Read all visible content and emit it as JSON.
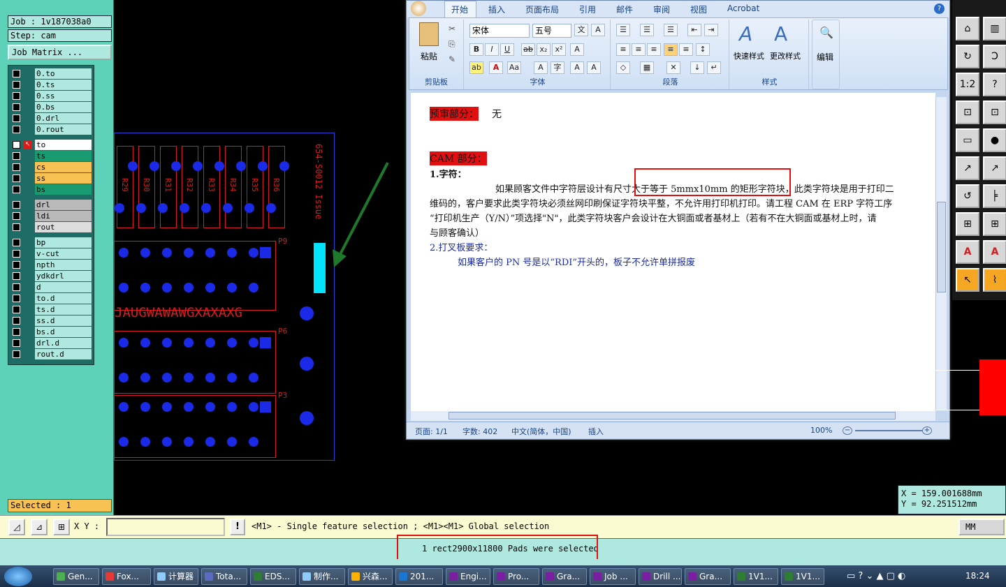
{
  "left": {
    "job": "Job : 1v187038a0",
    "step": "Step: cam",
    "job_matrix": "Job Matrix ...",
    "layers_group1": [
      "0.to",
      "0.ts",
      "0.ss",
      "0.bs",
      "0.drl",
      "0.rout"
    ],
    "layers_group2": [
      {
        "name": "to",
        "color": "#ffffff"
      },
      {
        "name": "ts",
        "color": "#1a9a70"
      },
      {
        "name": "cs",
        "color": "#f7c153"
      },
      {
        "name": "ss",
        "color": "#f7c153"
      },
      {
        "name": "bs",
        "color": "#1a9a70"
      }
    ],
    "layers_group3": [
      "drl",
      "ldi",
      "rout"
    ],
    "layers_group4": [
      "bp",
      "v-cut",
      "npth",
      "ydkdrl",
      "d",
      "to.d",
      "ts.d",
      "ss.d",
      "bs.d",
      "drl.d",
      "rout.d"
    ],
    "selected": "Selected : 1"
  },
  "canvas": {
    "resistors": [
      "R29",
      "R30",
      "R31",
      "R32",
      "R33",
      "R34",
      "R35",
      "R36"
    ],
    "side_text": "654-S0012 Issue",
    "connectors": [
      "P9",
      "P6",
      "P3"
    ],
    "char_row": "JAUGWAWAWGXAXAXG"
  },
  "word": {
    "tabs": [
      "开始",
      "插入",
      "页面布局",
      "引用",
      "邮件",
      "审阅",
      "视图",
      "Acrobat"
    ],
    "font_name": "宋体",
    "font_size": "五号",
    "groups": {
      "clipboard": "剪贴板",
      "font": "字体",
      "paragraph": "段落",
      "styles": "样式"
    },
    "paste": "粘贴",
    "quick_style": "快速样式",
    "change_style": "更改样式",
    "edit": "编辑",
    "doc": {
      "h1": "预审部分：",
      "h1_after": "无",
      "h2": "CAM 部分：",
      "item1": "1.字符：",
      "p1_line1": "如果顾客文件中字符层设计有尺寸大于等于 5mmx10mm 的矩形字符块，此类字符块是用于打印二",
      "p1_line2": "维码的，客户要求此类字符块必须丝网印刷保证字符块平整，不允许用打印机打印。请工程 CAM 在 ERP 字符工序",
      "p1_line3": "“打印机生产（Y/N）”项选择\"N\"，此类字符块客户会设计在大铜面或者基材上（若有不在大铜面或基材上时，请",
      "p1_line4": "与顾客确认）",
      "item2": "2.打叉板要求：",
      "p2": "如果客户的 PN 号是以“RDI”开头的，板子不允许单拼报废"
    },
    "status": {
      "page": "页面: 1/1",
      "words": "字数: 402",
      "lang": "中文(简体，中国)",
      "mode": "插入",
      "zoom": "100%"
    }
  },
  "coords": {
    "x": "X = 159.001688mm",
    "y": "Y = 92.251512mm"
  },
  "cmd": {
    "xy_label": "X Y :",
    "hint": "<M1> - Single feature selection ; <M1><M1> Global selection",
    "units": "MM"
  },
  "message": "1 rect2900x11800 Pads were selected",
  "taskbar": {
    "items": [
      "Gen...",
      "Fox...",
      "计算器",
      "Tota...",
      "EDS...",
      "制作...",
      "兴森...",
      "201...",
      "Engi...",
      "Pro...",
      "Gra...",
      "Job ...",
      "Drill ...",
      "Gra...",
      "1V1...",
      "1V1..."
    ],
    "clock": "18:24"
  },
  "colors": {
    "panel": "#5ed2b8",
    "pad": "#1a2ae6",
    "red": "#d81b1b",
    "cyan": "#00e5ff",
    "highlight_red": "#e01010"
  }
}
